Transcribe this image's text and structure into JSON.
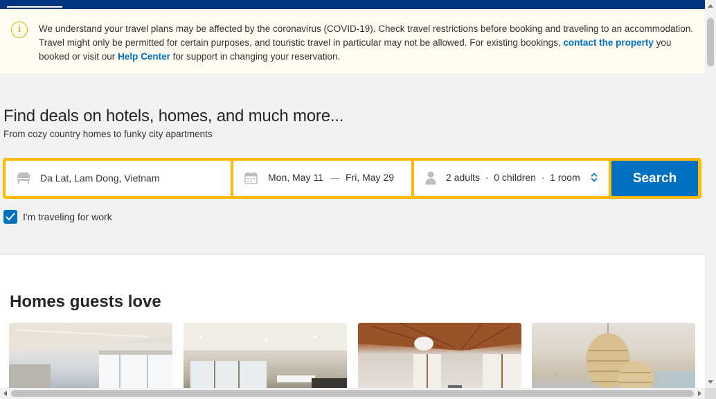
{
  "alert": {
    "icon": "info-icon",
    "text_1": "We understand your travel plans may be affected by the coronavirus (COVID-19). Check travel restrictions before booking and traveling to an accommodation. Travel might only be permitted for certain purposes, and touristic travel in particular may not be allowed. For existing bookings, ",
    "link_contact": "contact the property",
    "text_2": " you booked or visit our ",
    "link_help": "Help Center",
    "text_3": " for support in changing your reservation."
  },
  "hero": {
    "title": "Find deals on hotels, homes, and much more...",
    "subtitle": "From cozy country homes to funky city apartments"
  },
  "search": {
    "destination": "Da Lat, Lam Dong, Vietnam",
    "checkin": "Mon, May 11",
    "dash": "—",
    "checkout": "Fri, May 29",
    "guests": "2 adults  ·  0 children  ·  1 room",
    "button": "Search",
    "work_label": "I'm traveling for work",
    "work_checked": true
  },
  "section": {
    "title": "Homes guests love"
  },
  "colors": {
    "brand_dark": "#003580",
    "accent": "#0071c2",
    "searchbox_border": "#febb02"
  }
}
